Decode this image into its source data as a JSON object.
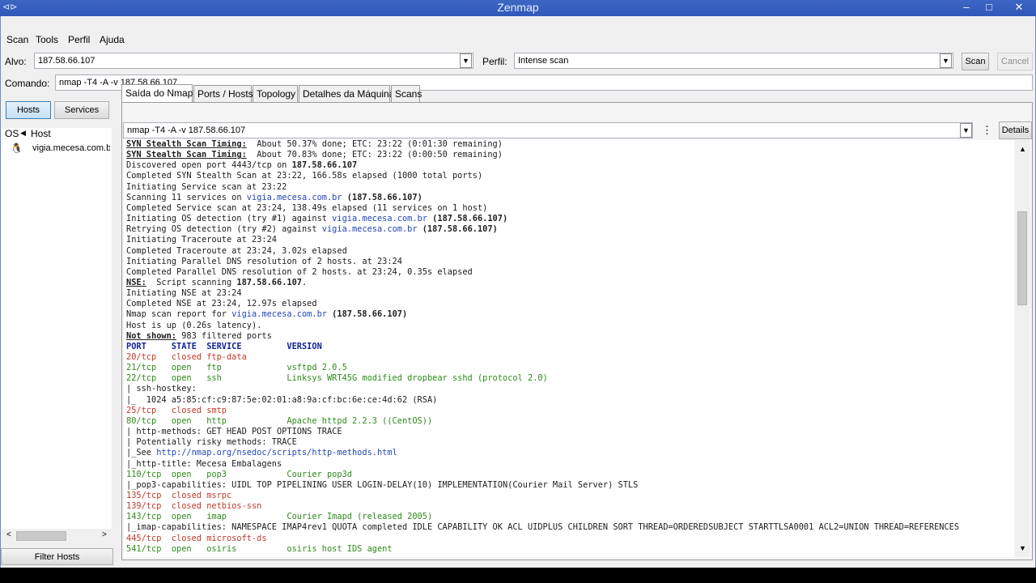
{
  "window": {
    "title": "Zenmap"
  },
  "menu": [
    "Scan",
    "Tools",
    "Perfil",
    "Ajuda"
  ],
  "target": {
    "label": "Alvo:",
    "value": "187.58.66.107"
  },
  "profile": {
    "label": "Perfil:",
    "value": "Intense scan"
  },
  "buttons": {
    "scan": "Scan",
    "cancel": "Cancel",
    "details": "Details",
    "filter_hosts": "Filter Hosts"
  },
  "command": {
    "label": "Comando:",
    "value": "nmap -T4 -A -v 187.58.66.107"
  },
  "left_panel": {
    "tabs": [
      "Hosts",
      "Services"
    ],
    "columns": [
      "OS",
      "Host"
    ],
    "hosts": [
      {
        "os_icon": "linux-penguin-icon",
        "name": "vigia.mecesa.com.b"
      }
    ]
  },
  "tabs": [
    "Saída do Nmap",
    "Ports / Hosts",
    "Topology",
    "Detalhes da Máquina",
    "Scans"
  ],
  "output_select": "nmap -T4 -A -v 187.58.66.107",
  "output": [
    [
      [
        "b u",
        "SYN Stealth Scan Timing:"
      ],
      [
        "",
        "  About 50.37% done; ETC: 23:22 (0:01:30 remaining)"
      ]
    ],
    [
      [
        "b u",
        "SYN Stealth Scan Timing:"
      ],
      [
        "",
        "  About 70.83% done; ETC: 23:22 (0:00:50 remaining)"
      ]
    ],
    [
      [
        "",
        "Discovered open port 4443/tcp on "
      ],
      [
        "b",
        "187.58.66.107"
      ]
    ],
    [
      [
        "",
        "Completed SYN Stealth Scan at 23:22, 166.58s elapsed (1000 total ports)"
      ]
    ],
    [
      [
        "",
        "Initiating Service scan at 23:22"
      ]
    ],
    [
      [
        "",
        "Scanning 11 services on "
      ],
      [
        "c-host",
        "vigia.mecesa.com.br"
      ],
      [
        "b",
        " (187.58.66.107)"
      ]
    ],
    [
      [
        "",
        "Completed Service scan at 23:24, 138.49s elapsed (11 services on 1 host)"
      ]
    ],
    [
      [
        "",
        "Initiating OS detection (try #1) against "
      ],
      [
        "c-host",
        "vigia.mecesa.com.br"
      ],
      [
        "b",
        " (187.58.66.107)"
      ]
    ],
    [
      [
        "",
        "Retrying OS detection (try #2) against "
      ],
      [
        "c-host",
        "vigia.mecesa.com.br"
      ],
      [
        "b",
        " (187.58.66.107)"
      ]
    ],
    [
      [
        "",
        "Initiating Traceroute at 23:24"
      ]
    ],
    [
      [
        "",
        "Completed Traceroute at 23:24, 3.02s elapsed"
      ]
    ],
    [
      [
        "",
        "Initiating Parallel DNS resolution of 2 hosts. at 23:24"
      ]
    ],
    [
      [
        "",
        "Completed Parallel DNS resolution of 2 hosts. at 23:24, 0.35s elapsed"
      ]
    ],
    [
      [
        "b u",
        "NSE:"
      ],
      [
        "",
        "  Script scanning "
      ],
      [
        "b",
        "187.58.66.107"
      ],
      [
        "",
        "."
      ]
    ],
    [
      [
        "",
        "Initiating NSE at 23:24"
      ]
    ],
    [
      [
        "",
        "Completed NSE at 23:24, 12.97s elapsed"
      ]
    ],
    [
      [
        "",
        "Nmap scan report for "
      ],
      [
        "c-host",
        "vigia.mecesa.com.br"
      ],
      [
        "b",
        " (187.58.66.107)"
      ]
    ],
    [
      [
        "",
        "Host is up (0.26s latency)."
      ]
    ],
    [
      [
        "b u",
        "Not shown:"
      ],
      [
        "",
        " 983 filtered ports"
      ]
    ],
    [
      [
        "c-hdr",
        "PORT     STATE  SERVICE         VERSION"
      ]
    ],
    [
      [
        "c-closed",
        "20/tcp   closed ftp-data"
      ]
    ],
    [
      [
        "c-open",
        "21/tcp   open   ftp             vsftpd 2.0.5"
      ]
    ],
    [
      [
        "c-open",
        "22/tcp   open   ssh             Linksys WRT45G modified dropbear sshd (protocol 2.0)"
      ]
    ],
    [
      [
        "",
        "| ssh-hostkey:"
      ]
    ],
    [
      [
        "",
        "|_  1024 a5:85:cf:c9:87:5e:02:01:a8:9a:cf:bc:6e:ce:4d:62 (RSA)"
      ]
    ],
    [
      [
        "c-closed",
        "25/tcp   closed smtp"
      ]
    ],
    [
      [
        "c-open",
        "80/tcp   open   http            Apache httpd 2.2.3 ((CentOS))"
      ]
    ],
    [
      [
        "",
        "| http-methods: GET HEAD POST OPTIONS TRACE"
      ]
    ],
    [
      [
        "",
        "| Potentially risky methods: TRACE"
      ]
    ],
    [
      [
        "",
        "|_See "
      ],
      [
        "c-host",
        "http://nmap.org/nsedoc/scripts/http-methods.html"
      ]
    ],
    [
      [
        "",
        "|_http-title: Mecesa Embalagens"
      ]
    ],
    [
      [
        "c-open",
        "110/tcp  open   pop3            Courier pop3d"
      ]
    ],
    [
      [
        "",
        "|_pop3-capabilities: UIDL TOP PIPELINING USER LOGIN-DELAY(10) IMPLEMENTATION(Courier Mail Server) STLS"
      ]
    ],
    [
      [
        "c-closed",
        "135/tcp  closed msrpc"
      ]
    ],
    [
      [
        "c-closed",
        "139/tcp  closed netbios-ssn"
      ]
    ],
    [
      [
        "c-open",
        "143/tcp  open   imap            Courier Imapd (released 2005)"
      ]
    ],
    [
      [
        "",
        "|_imap-capabilities: NAMESPACE IMAP4rev1 QUOTA completed IDLE CAPABILITY OK ACL UIDPLUS CHILDREN SORT THREAD=ORDEREDSUBJECT STARTTLSA0001 ACL2=UNION THREAD=REFERENCES"
      ]
    ],
    [
      [
        "c-closed",
        "445/tcp  closed microsoft-ds"
      ]
    ],
    [
      [
        "c-open",
        "541/tcp  open   osiris          osiris host IDS agent"
      ]
    ]
  ]
}
